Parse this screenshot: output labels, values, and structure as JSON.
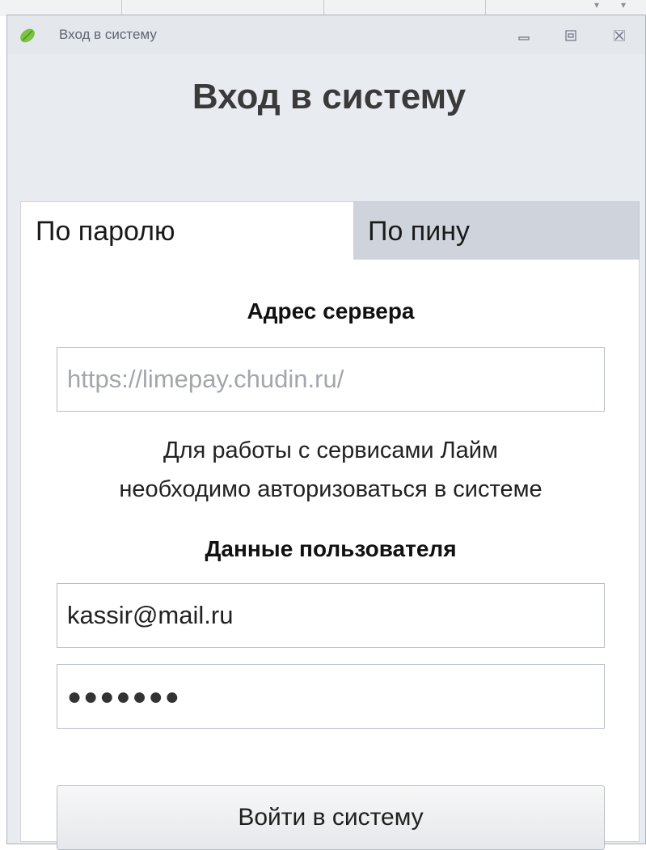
{
  "window": {
    "title": "Вход в систему",
    "icon": "lime-leaf-icon",
    "controls": [
      "minimize-icon",
      "restore-icon",
      "close-icon"
    ]
  },
  "heading": "Вход в систему",
  "tabs": [
    {
      "label": "По паролю",
      "active": true
    },
    {
      "label": "По пину",
      "active": false
    }
  ],
  "server": {
    "label": "Адрес сервера",
    "placeholder": "https://limepay.chudin.ru/",
    "value": ""
  },
  "hint": {
    "line1": "Для работы с сервисами Лайм",
    "line2": "необходимо авторизоваться в системе"
  },
  "user": {
    "label": "Данные пользователя",
    "login_value": "kassir@mail.ru",
    "password_mask": "●●●●●●●"
  },
  "login_button": "Войти в систему",
  "colors": {
    "window_bg": "#e8ebf0",
    "active_tab": "#ffffff",
    "inactive_tab": "#cfd4dc",
    "accent_leaf": "#7cc242"
  }
}
